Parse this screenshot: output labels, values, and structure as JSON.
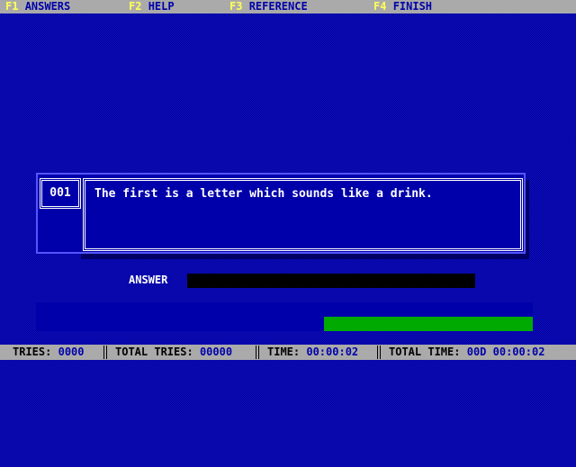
{
  "menu": {
    "items": [
      {
        "key": "F1",
        "label": "ANSWERS"
      },
      {
        "key": "F2",
        "label": "HELP"
      },
      {
        "key": "F3",
        "label": "REFERENCE"
      },
      {
        "key": "F4",
        "label": "FINISH"
      }
    ]
  },
  "question": {
    "number": "001",
    "text": "The first is a letter which sounds like a drink."
  },
  "answer": {
    "label": "ANSWER",
    "value": ""
  },
  "progress": {
    "fraction": 0.42
  },
  "status": {
    "tries_label": "TRIES:",
    "tries_value": "0000",
    "total_tries_label": "TOTAL TRIES:",
    "total_tries_value": "00000",
    "time_label": "TIME:",
    "time_value": "00:00:02",
    "total_time_label": "TOTAL TIME:",
    "total_time_value": "00D 00:00:02"
  },
  "colors": {
    "background": "#0000aa",
    "menu_key": "#ffff55",
    "progress_fill": "#00aa00",
    "status_value": "#0000aa"
  }
}
